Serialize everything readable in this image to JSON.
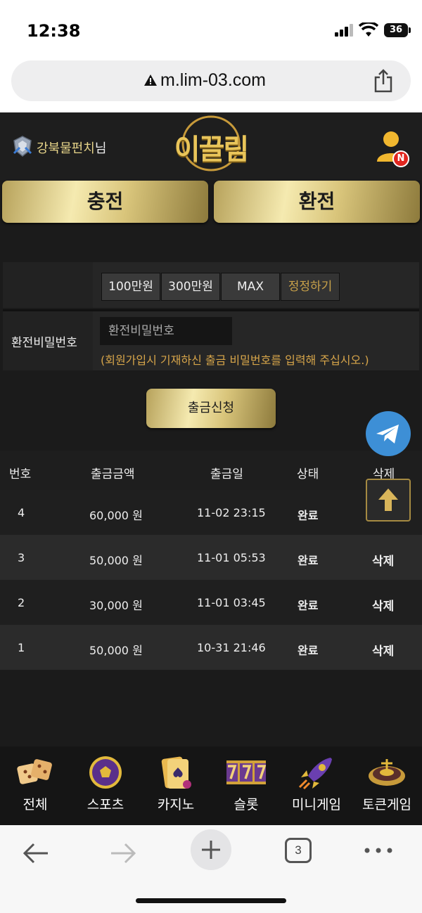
{
  "status_bar": {
    "time": "12:38",
    "battery": "36"
  },
  "browser": {
    "url": "m.lim-03.com",
    "tab_count": "3"
  },
  "header": {
    "username": "강북물펀치",
    "username_suffix": "님",
    "logo_text": "이끌림",
    "notification_badge": "N"
  },
  "tabs": {
    "charge": "충전",
    "exchange": "환전"
  },
  "form": {
    "amount_buttons": [
      "100만원",
      "300만원",
      "MAX"
    ],
    "reset_label": "정정하기",
    "password_label": "환전비밀번호",
    "password_placeholder": "환전비밀번호",
    "password_note": "(회원가입시 기재하신 출금 비밀번호를 입력해 주십시오.)",
    "submit_label": "출금신청"
  },
  "table": {
    "headers": [
      "번호",
      "출금금액",
      "출금일",
      "상태",
      "삭제"
    ],
    "rows": [
      {
        "no": "4",
        "amount": "60,000 원",
        "date": "11-02 23:15",
        "status": "완료",
        "delete": ""
      },
      {
        "no": "3",
        "amount": "50,000 원",
        "date": "11-01 05:53",
        "status": "완료",
        "delete": "삭제"
      },
      {
        "no": "2",
        "amount": "30,000 원",
        "date": "11-01 03:45",
        "status": "완료",
        "delete": "삭제"
      },
      {
        "no": "1",
        "amount": "50,000 원",
        "date": "10-31 21:46",
        "status": "완료",
        "delete": "삭제"
      }
    ]
  },
  "bottom_nav": [
    {
      "label": "전체",
      "icon": "dice-icon"
    },
    {
      "label": "스포츠",
      "icon": "soccer-ball-icon"
    },
    {
      "label": "카지노",
      "icon": "playing-cards-icon"
    },
    {
      "label": "슬롯",
      "icon": "slot-777-icon"
    },
    {
      "label": "미니게임",
      "icon": "rocket-icon"
    },
    {
      "label": "토큰게임",
      "icon": "roulette-icon"
    }
  ],
  "colors": {
    "accent_gold": "#e9c55a",
    "note_text": "#d7a54a",
    "telegram_blue": "#3d8fd6",
    "badge_red": "#e0261f"
  }
}
